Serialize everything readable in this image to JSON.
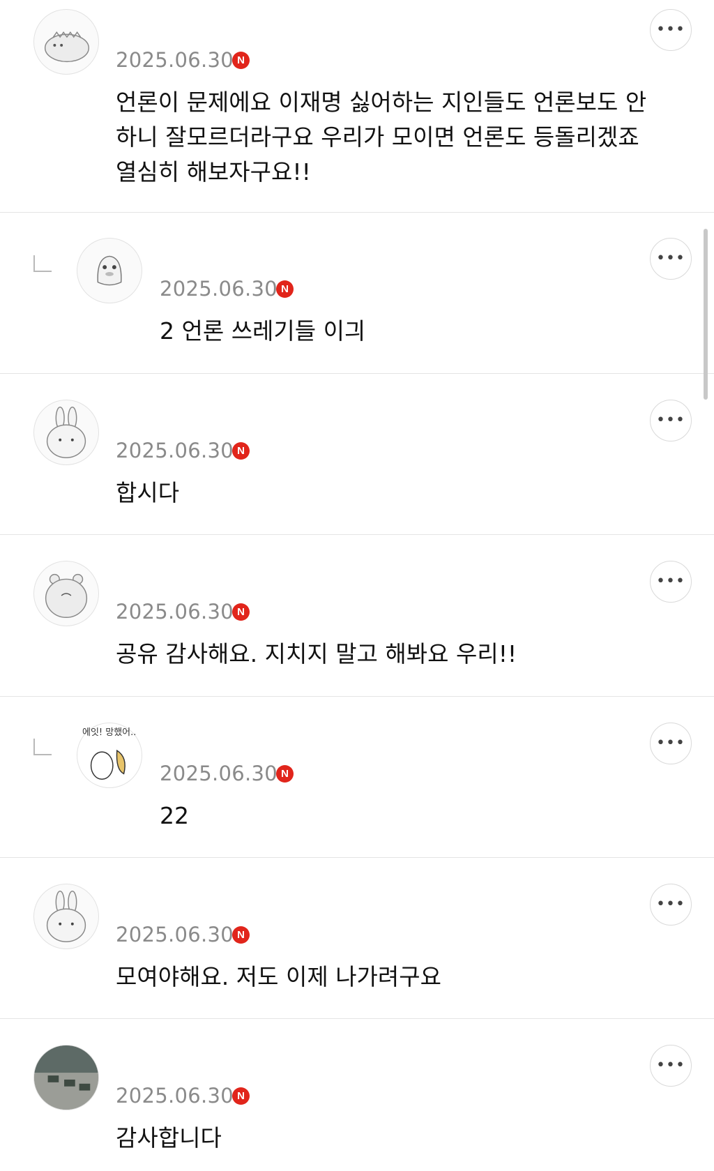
{
  "comments": [
    {
      "date": "2025.06.30",
      "badge": "N",
      "text": "언론이 문제에요 이재명 싫어하는 지인들도 언론보도 안\n하니 잘모르더라구요 우리가 모이면 언론도 등돌리겠죠\n열심히 해보자구요!!",
      "reply": false,
      "more": "•••",
      "avatar_icon": "dinosaur-avatar-icon"
    },
    {
      "date": "2025.06.30",
      "badge": "N",
      "text": "2 언론 쓰레기들 이긔",
      "reply": true,
      "more": "•••",
      "avatar_icon": "duck-avatar-icon"
    },
    {
      "date": "2025.06.30",
      "badge": "N",
      "text": "합시다",
      "reply": false,
      "more": "•••",
      "avatar_icon": "rabbit-avatar-icon"
    },
    {
      "date": "2025.06.30",
      "badge": "N",
      "text": "공유 감사해요. 지치지 말고 해봐요 우리!!",
      "reply": false,
      "more": "•••",
      "avatar_icon": "hamster-avatar-icon"
    },
    {
      "date": "2025.06.30",
      "badge": "N",
      "text": "22",
      "reply": true,
      "more": "•••",
      "avatar_icon": "cartoon-avatar-icon",
      "avatar_caption": "에잇! 망했어.."
    },
    {
      "date": "2025.06.30",
      "badge": "N",
      "text": "모여야해요. 저도 이제 나가려구요",
      "reply": false,
      "more": "•••",
      "avatar_icon": "rabbit-avatar-icon"
    },
    {
      "date": "2025.06.30",
      "badge": "N",
      "text": "감사합니다",
      "reply": false,
      "more": "•••",
      "avatar_icon": "photo-avatar-icon"
    }
  ],
  "colors": {
    "badge": "#e1251b",
    "date": "#8a8a8a",
    "divider": "#e4e4e4"
  }
}
